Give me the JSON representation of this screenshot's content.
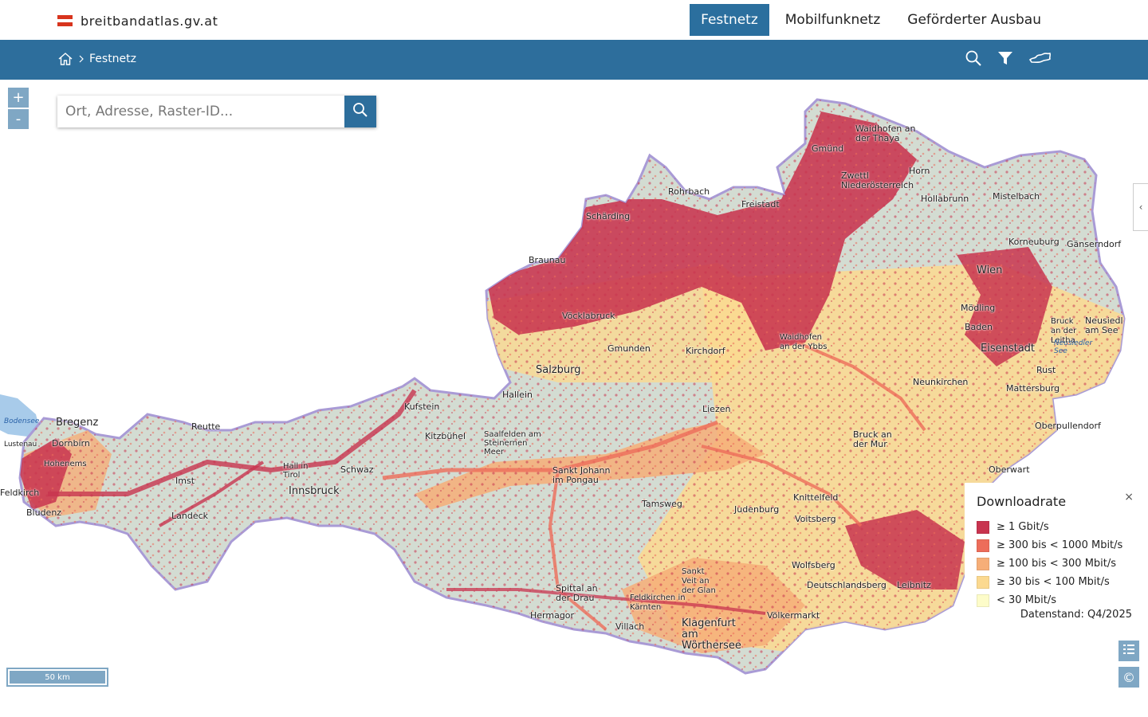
{
  "brand": {
    "name": "breitbandatlas.gv.at"
  },
  "topnav": [
    {
      "label": "Festnetz",
      "active": true
    },
    {
      "label": "Mobilfunknetz",
      "active": false
    },
    {
      "label": "Geförderter Ausbau",
      "active": false
    }
  ],
  "breadcrumb": {
    "current": "Festnetz"
  },
  "tools": {
    "search_icon": "search-icon",
    "filter_icon": "filter-icon",
    "map_icon": "map-outline-icon"
  },
  "zoom": {
    "in": "+",
    "out": "-"
  },
  "search": {
    "placeholder": "Ort, Adresse, Raster-ID..."
  },
  "legend": {
    "title": "Downloadrate",
    "close": "×",
    "items": [
      {
        "label": "≥ 1 Gbit/s",
        "color": "#c8344f"
      },
      {
        "label": "≥ 300 bis < 1000 Mbit/s",
        "color": "#ed6d5a"
      },
      {
        "label": "≥ 100 bis < 300 Mbit/s",
        "color": "#f6ae78"
      },
      {
        "label": "≥ 30 bis < 100 Mbit/s",
        "color": "#fbd990"
      },
      {
        "label": "< 30 Mbit/s",
        "color": "#fdfcc9"
      }
    ],
    "datenstand": "Datenstand: Q4/2025"
  },
  "scale": {
    "label": "50 km"
  },
  "map_labels": [
    "Waidhofen an der Thaya",
    "Gmünd",
    "Zwettl Niederösterreich",
    "Horn",
    "Hollabrunn",
    "Mistelbach",
    "Rohrbach",
    "Schärding",
    "Freistadt",
    "Braunau",
    "Gänserndorf",
    "Korneuburg",
    "Wien",
    "Vöcklabruck",
    "Gmunden",
    "Kirchdorf",
    "Mödling",
    "Baden",
    "Eisenstadt",
    "Rust",
    "Salzburg",
    "Hallein",
    "Neunkirchen",
    "Mattersburg",
    "Bodensee",
    "Bregenz",
    "Dornbirn",
    "Reutte",
    "Kufstein",
    "Kitzbühel",
    "Saalfelden am Steinernen Meer",
    "Liezen",
    "Bruck an der Mur",
    "Oberpullendorf",
    "Lustenau",
    "Hohenems",
    "Feldkirch",
    "Bludenz",
    "Hall in Tirol",
    "Schwaz",
    "Imst",
    "Innsbruck",
    "Landeck",
    "Sankt Johann im Pongau",
    "Tamsweg",
    "Judenburg",
    "Knittelfeld",
    "Voitsberg",
    "Oberwart",
    "Wolfsberg",
    "Deutschlandsberg",
    "Leibnitz",
    "Spittal an der Drau",
    "Feldkirchen in Kärnten",
    "Villach",
    "Klagenfurt am Wörthersee",
    "Völkermarkt",
    "Hermagor",
    "Neusiedl am See",
    "Bruck an der Leitha",
    "Sankt Veit an der Glan",
    "Waidhofen an der Ybbs",
    "Neusiedler See"
  ]
}
